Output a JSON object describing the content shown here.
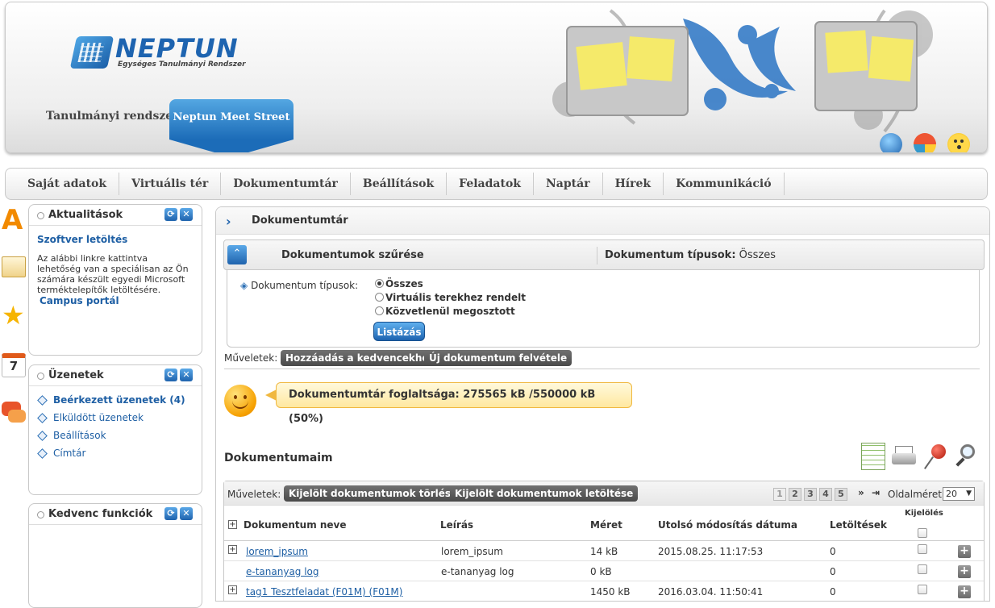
{
  "header": {
    "logo_text": "NEPTUN",
    "logo_subtitle": "Egységes Tanulmányi Rendszer",
    "tabs": [
      {
        "label": "Tanulmányi rendszer"
      },
      {
        "label": "Neptun Meet Street"
      }
    ]
  },
  "menu": {
    "items": [
      {
        "label": "Saját adatok"
      },
      {
        "label": "Virtuális tér"
      },
      {
        "label": "Dokumentumtár"
      },
      {
        "label": "Beállítások"
      },
      {
        "label": "Feladatok"
      },
      {
        "label": "Naptár"
      },
      {
        "label": "Hírek"
      },
      {
        "label": "Kommunikáció"
      }
    ]
  },
  "side_icons": {
    "calendar_day": "7"
  },
  "panels": {
    "news": {
      "title": "Aktualitások",
      "headline": "Szoftver letöltés",
      "text": "Az alábbi linkre kattintva lehetőség van a speciálisan az Ön számára készült egyedi Microsoft terméktelepítők letöltésére.",
      "link": "Campus portál"
    },
    "messages": {
      "title": "Üzenetek",
      "items": [
        {
          "label": "Beérkezett üzenetek (4)"
        },
        {
          "label": "Elküldött üzenetek"
        },
        {
          "label": "Beállítások"
        },
        {
          "label": "Címtár"
        }
      ]
    },
    "favorites": {
      "title": "Kedvenc funkciók"
    }
  },
  "main": {
    "title": "Dokumentumtár",
    "filter": {
      "title": "Dokumentumok szűrése",
      "type_label": "Dokumentum típusok:",
      "type_value": "Összes",
      "field_label": "Dokumentum típusok:",
      "options": [
        {
          "label": "Összes",
          "selected": true
        },
        {
          "label": "Virtuális terekhez rendelt",
          "selected": false
        },
        {
          "label": "Közvetlenül megosztott",
          "selected": false
        }
      ],
      "submit_label": "Listázás"
    },
    "ops_label": "Műveletek:",
    "ops_buttons": [
      "Hozzáadás a kedvencekhez",
      "Új dokumentum felvétele"
    ],
    "usage_text": "Dokumentumtár foglaltsága: 275565 kB /550000 kB (50%)",
    "docs_title": "Dokumentumaim",
    "grid": {
      "ops_label": "Műveletek:",
      "ops_buttons": [
        "Kijelölt dokumentumok törlése",
        "Kijelölt dokumentumok letöltése"
      ],
      "pages": [
        "1",
        "2",
        "3",
        "4",
        "5"
      ],
      "page_size_label": "Oldalméret",
      "page_size": "20",
      "columns": [
        "Dokumentum neve",
        "Leírás",
        "Méret",
        "Utolsó módosítás dátuma",
        "Letöltések",
        "Kijelölés"
      ],
      "rows": [
        {
          "name": "lorem_ipsum",
          "desc": "lorem_ipsum",
          "size": "14 kB",
          "date": "2015.08.25. 11:17:53",
          "downloads": "0",
          "expandable": true
        },
        {
          "name": "e-tananyag log",
          "desc": "e-tananyag log",
          "size": "0 kB",
          "date": "",
          "downloads": "0",
          "expandable": false
        },
        {
          "name": "tag1 Tesztfeladat (F01M) (F01M)",
          "desc": "",
          "size": "1450 kB",
          "date": "2016.03.04. 11:50:41",
          "downloads": "0",
          "expandable": true
        }
      ]
    }
  },
  "colors": {
    "accent": "#1e64b0",
    "dark_button": "#555555",
    "usage_bubble": "#ffe8a0"
  }
}
